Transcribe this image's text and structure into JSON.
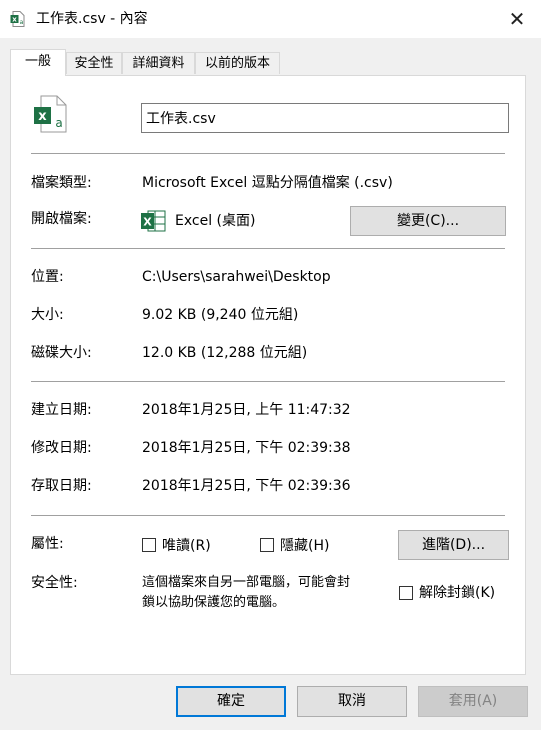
{
  "window": {
    "title": "工作表.csv - 內容"
  },
  "tabs": [
    {
      "label": "一般"
    },
    {
      "label": "安全性"
    },
    {
      "label": "詳細資料"
    },
    {
      "label": "以前的版本"
    }
  ],
  "general": {
    "file_name": "工作表.csv",
    "file_type_label": "檔案類型:",
    "file_type_value": "Microsoft Excel 逗點分隔值檔案 (.csv)",
    "opens_with_label": "開啟檔案:",
    "opens_with_value": "Excel (桌面)",
    "change_button": "變更(C)...",
    "location_label": "位置:",
    "location_value": "C:\\Users\\sarahwei\\Desktop",
    "size_label": "大小:",
    "size_value": "9.02 KB (9,240 位元組)",
    "size_on_disk_label": "磁碟大小:",
    "size_on_disk_value": "12.0 KB (12,288 位元組)",
    "created_label": "建立日期:",
    "created_value": "2018年1月25日, 上午 11:47:32",
    "modified_label": "修改日期:",
    "modified_value": "2018年1月25日, 下午 02:39:38",
    "accessed_label": "存取日期:",
    "accessed_value": "2018年1月25日, 下午 02:39:36",
    "attributes_label": "屬性:",
    "readonly_label": "唯讀(R)",
    "hidden_label": "隱藏(H)",
    "advanced_button": "進階(D)...",
    "security_label": "安全性:",
    "security_text_line1": "這個檔案來自另一部電腦，可能會封",
    "security_text_line2": "鎖以協助保護您的電腦。",
    "unblock_label": "解除封鎖(K)"
  },
  "footer": {
    "ok": "確定",
    "cancel": "取消",
    "apply": "套用(A)"
  },
  "colors": {
    "excel_green": "#1e7145",
    "primary_border": "#0078d7"
  }
}
